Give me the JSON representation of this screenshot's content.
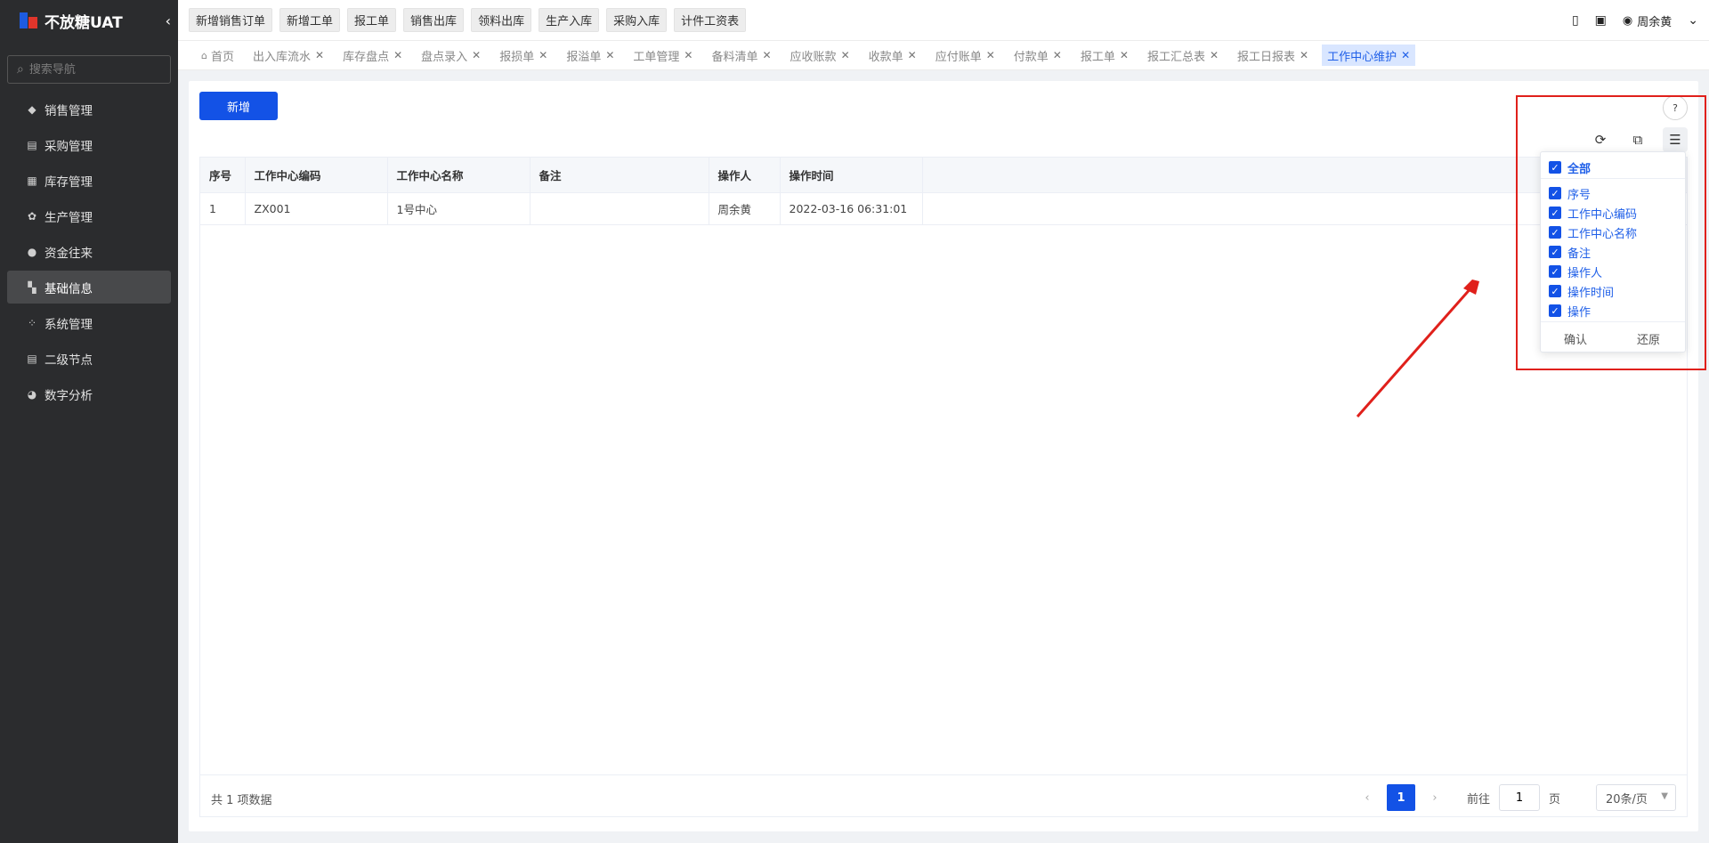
{
  "sidebar": {
    "brand": "不放糖UAT",
    "search_placeholder": "搜索导航",
    "items": [
      {
        "label": "销售管理"
      },
      {
        "label": "采购管理"
      },
      {
        "label": "库存管理"
      },
      {
        "label": "生产管理"
      },
      {
        "label": "资金往来"
      },
      {
        "label": "基础信息"
      },
      {
        "label": "系统管理"
      },
      {
        "label": "二级节点"
      },
      {
        "label": "数字分析"
      }
    ]
  },
  "topbar": {
    "quick_buttons": [
      "新增销售订单",
      "新增工单",
      "报工单",
      "销售出库",
      "领料出库",
      "生产入库",
      "采购入库",
      "计件工资表"
    ],
    "user_name": "周余黄"
  },
  "tabs": [
    {
      "label": "首页"
    },
    {
      "label": "出入库流水"
    },
    {
      "label": "库存盘点"
    },
    {
      "label": "盘点录入"
    },
    {
      "label": "报损单"
    },
    {
      "label": "报溢单"
    },
    {
      "label": "工单管理"
    },
    {
      "label": "备料清单"
    },
    {
      "label": "应收账款"
    },
    {
      "label": "收款单"
    },
    {
      "label": "应付账单"
    },
    {
      "label": "付款单"
    },
    {
      "label": "报工单"
    },
    {
      "label": "报工汇总表"
    },
    {
      "label": "报工日报表"
    },
    {
      "label": "工作中心维护"
    }
  ],
  "main": {
    "new_button": "新增",
    "table": {
      "headers": [
        "序号",
        "工作中心编码",
        "工作中心名称",
        "备注",
        "操作人",
        "操作时间"
      ],
      "rows": [
        [
          "1",
          "ZX001",
          "1号中心",
          "",
          "周余黄",
          "2022-03-16 06:31:01"
        ]
      ]
    },
    "footer": {
      "total": "共 1 项数据",
      "current_page": "1",
      "goto_label": "前往",
      "goto_value": "1",
      "page_suffix": "页",
      "page_size": "20条/页"
    }
  },
  "column_settings": {
    "all_label": "全部",
    "columns": [
      "序号",
      "工作中心编码",
      "工作中心名称",
      "备注",
      "操作人",
      "操作时间",
      "操作"
    ],
    "confirm": "确认",
    "reset": "还原"
  },
  "colors": {
    "primary": "#1352e6",
    "sidebar_bg": "#2b2c2e",
    "annotation": "#e0201b"
  }
}
